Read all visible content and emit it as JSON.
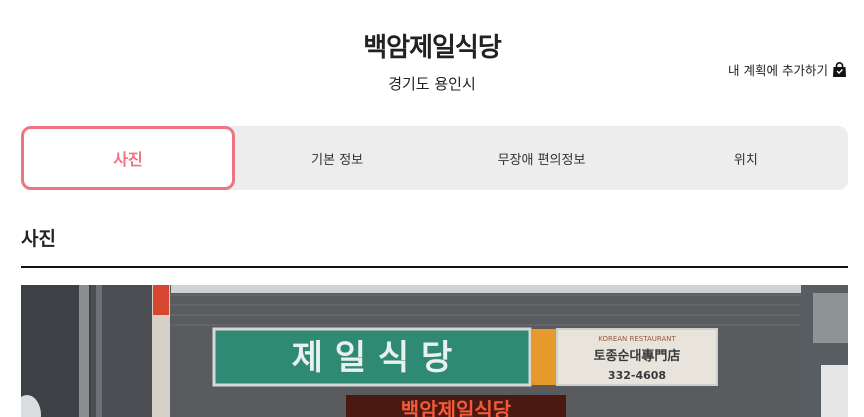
{
  "header": {
    "title": "백암제일식당",
    "subtitle": "경기도 용인시",
    "add_plan_label": "내 계획에 추가하기",
    "add_plan_icon": "shopping-bag-icon"
  },
  "tabs": [
    {
      "label": "사진",
      "active": true
    },
    {
      "label": "기본 정보",
      "active": false
    },
    {
      "label": "무장애 편의정보",
      "active": false
    },
    {
      "label": "위치",
      "active": false
    }
  ],
  "section": {
    "title": "사진"
  },
  "photo": {
    "sign_main": "제 일 식 당",
    "sign_side_top": "KOREAN RESTAURANT",
    "sign_side_mid": "토종순대專門店",
    "sign_side_phone": "332-4608",
    "sign_neon": "백암제일식당"
  },
  "colors": {
    "accent": "#f07480",
    "tab_bg": "#ededed",
    "sign_green": "#2f8a74"
  }
}
